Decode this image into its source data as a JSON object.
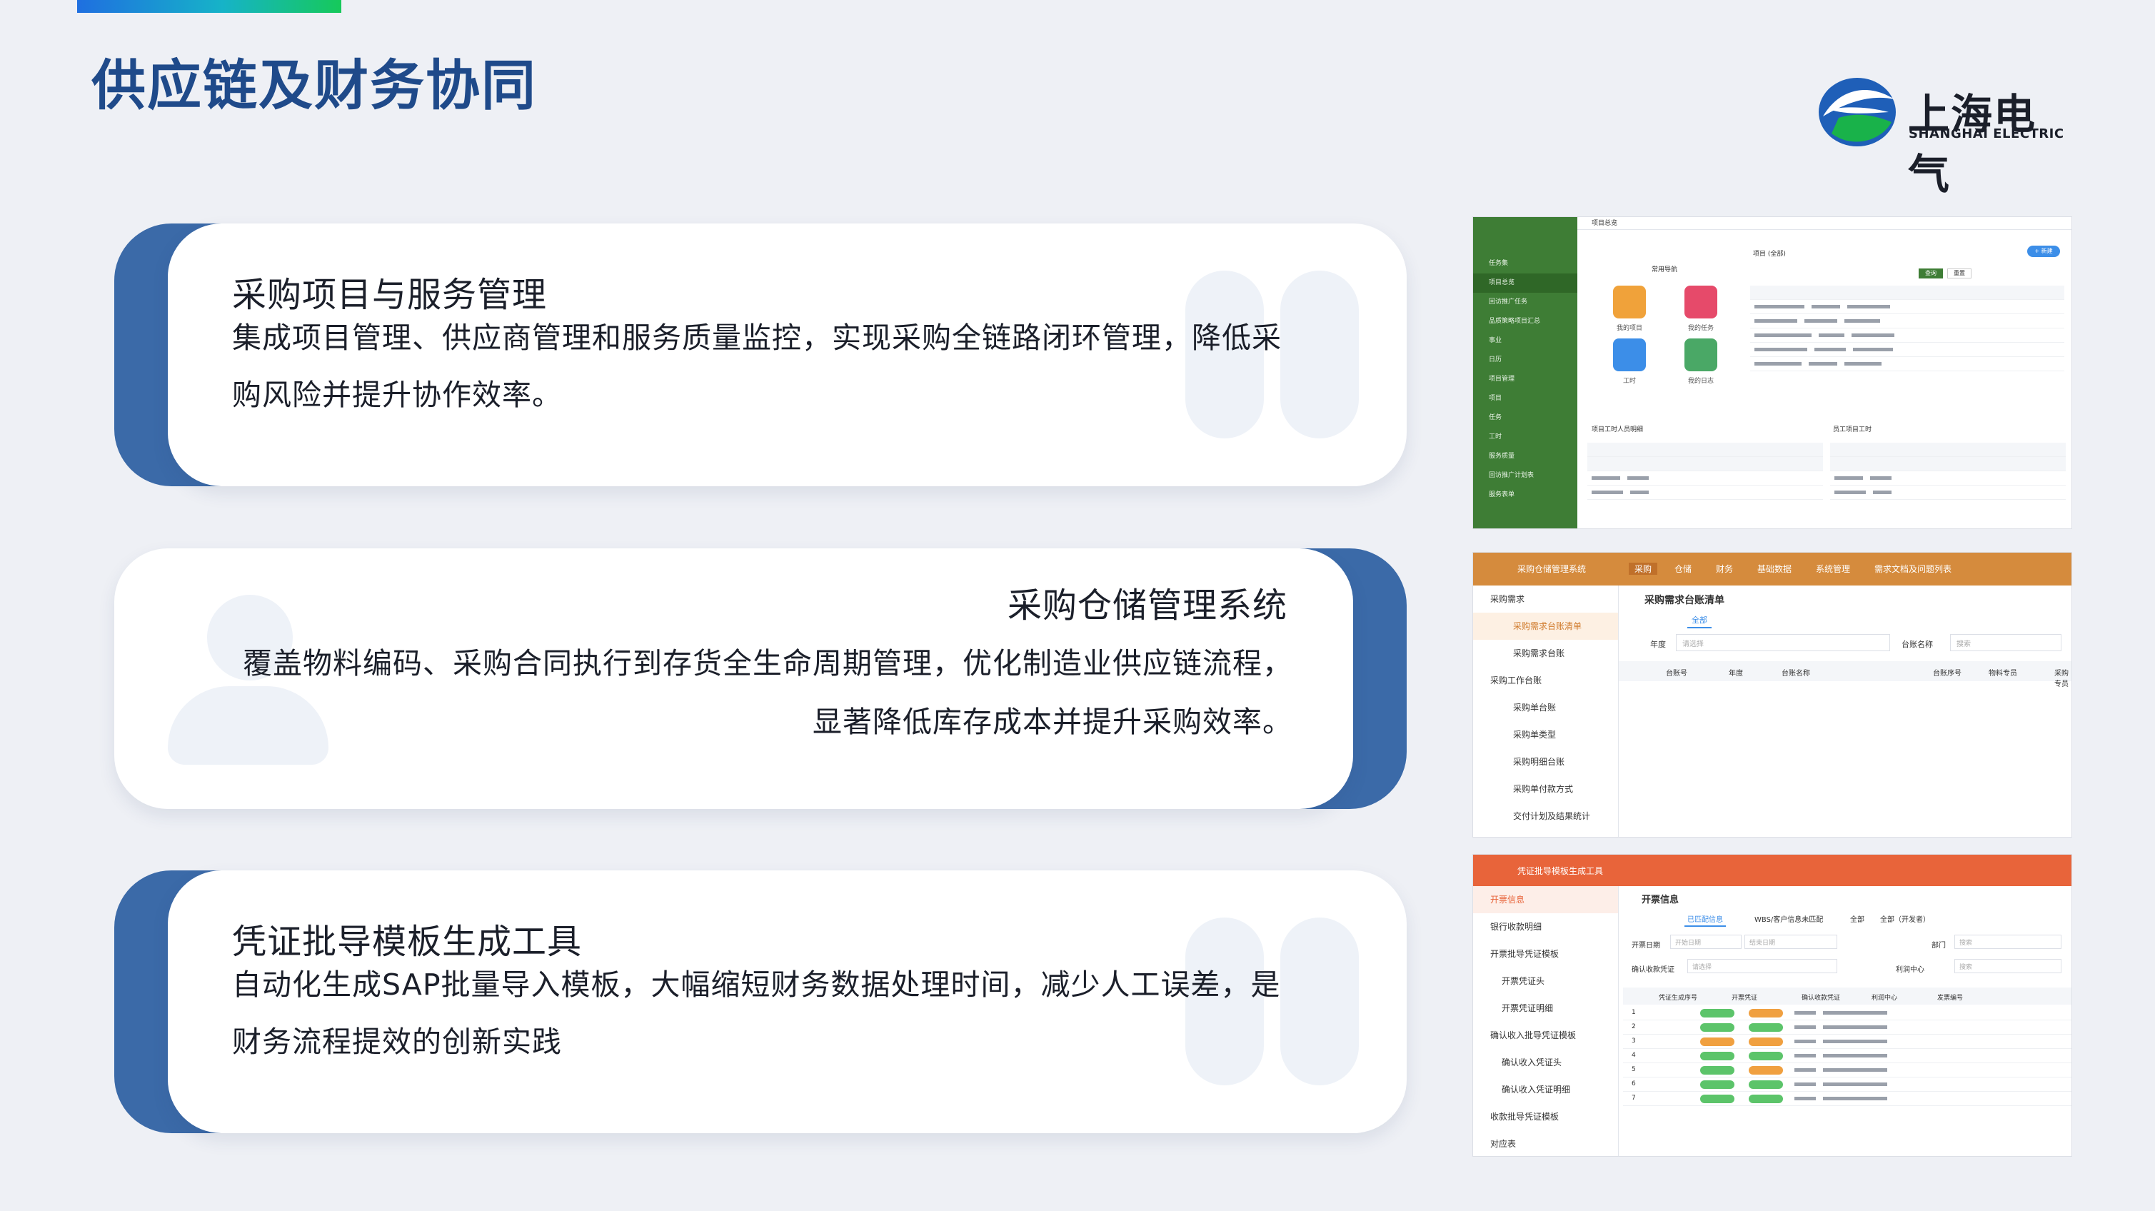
{
  "page": {
    "title": "供应链及财务协同"
  },
  "logo": {
    "name_cn": "上海电气",
    "name_en": "SHANGHAI ELECTRIC"
  },
  "cards": [
    {
      "title": "采购项目与服务管理",
      "lines": [
        "集成项目管理、供应商管理和服务质量监控，实现采购全链路闭环管理，降低采",
        "购风险并提升协作效率。"
      ]
    },
    {
      "title": "采购仓储管理系统",
      "lines": [
        "覆盖物料编码、采购合同执行到存货全生命周期管理，优化制造业供应链流程，",
        "显著降低库存成本并提升采购效率。"
      ]
    },
    {
      "title": "凭证批导模板生成工具",
      "lines": [
        "自动化生成SAP批量导入模板，大幅缩短财务数据处理时间，减少人工误差，是",
        "财务流程提效的创新实践"
      ]
    }
  ],
  "shot1": {
    "breadcrumb": "项目总览",
    "quick_title": "常用导航",
    "tiles": [
      "我的项目",
      "我的任务",
      "工时",
      "我的日志"
    ],
    "sidebar": [
      "任务集",
      "项目总览",
      "回访推广任务",
      "品质策略项目汇总",
      "事业",
      "日历",
      "项目管理",
      "项目",
      "任务",
      "工时",
      "服务质量",
      "回访推广计划表",
      "服务表单"
    ],
    "list_title": "项目 (全部)",
    "query_btn": "查询",
    "reset_btn": "重置",
    "new_btn": "+ 新建",
    "panel_left": "项目工时人员明细",
    "panel_right": "员工项目工时"
  },
  "shot2": {
    "app": "采购仓储管理系统",
    "top_tabs": [
      "采购",
      "仓储",
      "财务",
      "基础数据",
      "系统管理",
      "需求文档及问题列表"
    ],
    "sidebar": [
      "采购需求",
      "采购需求台账清单",
      "采购需求台账",
      "采购工作台账",
      "采购单台账",
      "采购单类型",
      "采购明细台账",
      "采购单付款方式",
      "交付计划及结果统计"
    ],
    "page_title": "采购需求台账清单",
    "tab_all": "全部",
    "filter_year": "年度",
    "filter_ledger": "台账名称",
    "placeholder_select": "请选择",
    "placeholder_search": "搜索",
    "columns": [
      "台账号",
      "年度",
      "台账名称",
      "台账序号",
      "物料专员",
      "采购专员"
    ]
  },
  "shot3": {
    "app": "凭证批导模板生成工具",
    "sidebar": [
      "开票信息",
      "银行收款明细",
      "开票批导凭证模板",
      "开票凭证头",
      "开票凭证明细",
      "确认收入批导凭证模板",
      "确认收入凭证头",
      "确认收入凭证明细",
      "收款批导凭证模板",
      "对应表"
    ],
    "page_title": "开票信息",
    "tabs": [
      "已匹配信息",
      "WBS/客户信息未匹配",
      "全部",
      "全部（开发者）"
    ],
    "filters": [
      "开票日期",
      "部门",
      "确认收款凭证",
      "利润中心"
    ],
    "columns": [
      "凭证生成序号",
      "开票凭证",
      "确认收款凭证",
      "利润中心",
      "发票编号"
    ],
    "placeholder_start": "开始日期",
    "placeholder_end": "结束日期",
    "placeholder_select": "请选择",
    "placeholder_search": "搜索",
    "row_numbers": [
      "1",
      "2",
      "3",
      "4",
      "5",
      "6",
      "7"
    ]
  },
  "colors": {
    "title_blue": "#1f4a8a",
    "card_back_blue": "#3b6aa8",
    "green": "#3e7d35",
    "orange": "#d58b3d",
    "red_orange": "#e8643a"
  }
}
